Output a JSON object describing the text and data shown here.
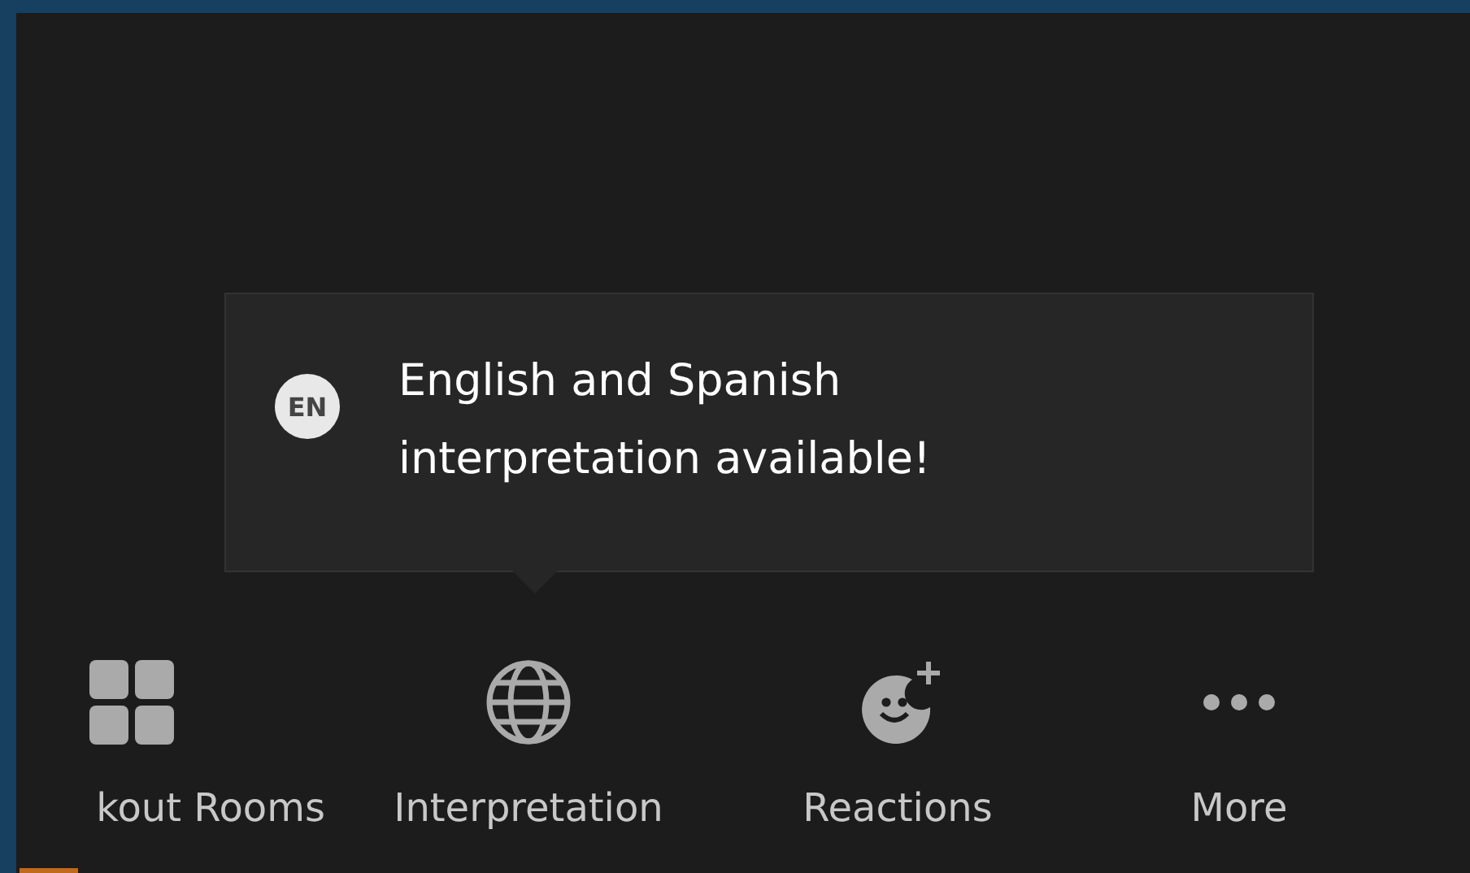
{
  "tooltip": {
    "badge": "EN",
    "lines": [
      "English and Spanish",
      "interpretation available!"
    ]
  },
  "toolbar": [
    {
      "kind": "grid",
      "label": "kout Rooms",
      "cut": true
    },
    {
      "kind": "globe",
      "label": "Interpretation",
      "cut": false
    },
    {
      "kind": "reaction",
      "label": "Reactions",
      "cut": false
    },
    {
      "kind": "dots",
      "label": "More",
      "cut": false
    }
  ]
}
